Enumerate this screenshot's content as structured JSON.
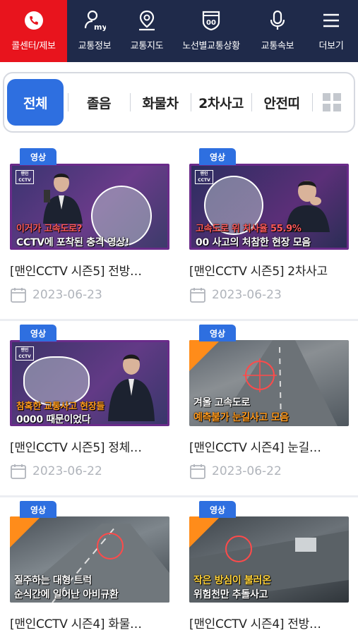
{
  "nav": {
    "items": [
      {
        "label": "콜센터/제보",
        "icon": "phone-icon",
        "active": true
      },
      {
        "label": "교통정보",
        "icon": "my-person-icon",
        "active": false
      },
      {
        "label": "교통지도",
        "icon": "map-pin-icon",
        "active": false
      },
      {
        "label": "노선별교통상황",
        "icon": "route-shield-icon",
        "active": false
      },
      {
        "label": "교통속보",
        "icon": "microphone-icon",
        "active": false
      },
      {
        "label": "더보기",
        "icon": "hamburger-menu-icon",
        "active": false
      }
    ],
    "bg_color": "#1f2a4a",
    "active_color": "#e8141d"
  },
  "tabs": {
    "items": [
      "전체",
      "졸음",
      "화물차",
      "2차사고",
      "안전띠"
    ],
    "selected": "전체",
    "accent_color": "#2e6fe0"
  },
  "cards": [
    {
      "badge": "영상",
      "title": "[맨인CCTV 시즌5] 전방…",
      "date": "2023-06-23",
      "thumb_lines": [
        "이거가 고속도로?",
        "CCTV에 포착된 충격 영상!"
      ],
      "logo": "맨인 CCTV"
    },
    {
      "badge": "영상",
      "title": "[맨인CCTV 시즌5] 2차사고",
      "date": "2023-06-23",
      "thumb_lines": [
        "고속도로 위 치사율 55.9%",
        "00 사고의 처참한 현장 모음"
      ],
      "logo": "맨인 CCTV"
    },
    {
      "badge": "영상",
      "title": "[맨인CCTV 시즌5] 정체…",
      "date": "2023-06-22",
      "thumb_lines": [
        "참혹한 교통사고 현장들",
        "0000 때문이었다"
      ],
      "logo": "맨인 CCTV"
    },
    {
      "badge": "영상",
      "title": "[맨인CCTV 시즌4] 눈길…",
      "date": "2023-06-22",
      "thumb_lines": [
        "겨울 고속도로",
        "예측불가 눈길사고 모음"
      ],
      "logo": ""
    },
    {
      "badge": "영상",
      "title": "[맨인CCTV 시즌4] 화물…",
      "date": "",
      "thumb_lines": [
        "질주하는 대형 트럭",
        "순식간에 일어난 아비규환"
      ],
      "logo": ""
    },
    {
      "badge": "영상",
      "title": "[맨인CCTV 시즌4] 전방…",
      "date": "",
      "thumb_lines": [
        "작은 방심이 불러온",
        "위험천만 추돌사고"
      ],
      "logo": ""
    }
  ]
}
